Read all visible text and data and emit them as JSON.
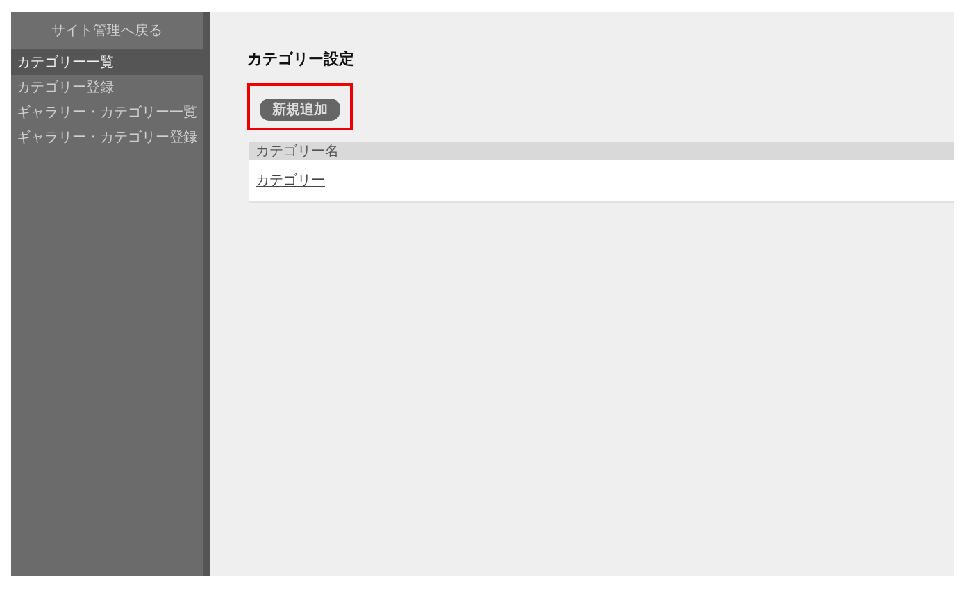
{
  "sidebar": {
    "back_link": "サイト管理へ戻る",
    "items": [
      {
        "label": "カテゴリー一覧",
        "selected": true
      },
      {
        "label": "カテゴリー登録",
        "selected": false
      },
      {
        "label": "ギャラリー・カテゴリー一覧",
        "selected": false
      },
      {
        "label": "ギャラリー・カテゴリー登録",
        "selected": false
      }
    ]
  },
  "main": {
    "title": "カテゴリー設定",
    "add_button": {
      "label": "新規追加",
      "highlighted": true
    },
    "table": {
      "columns": [
        "カテゴリー名"
      ],
      "rows": [
        [
          "カテゴリー"
        ]
      ]
    }
  }
}
